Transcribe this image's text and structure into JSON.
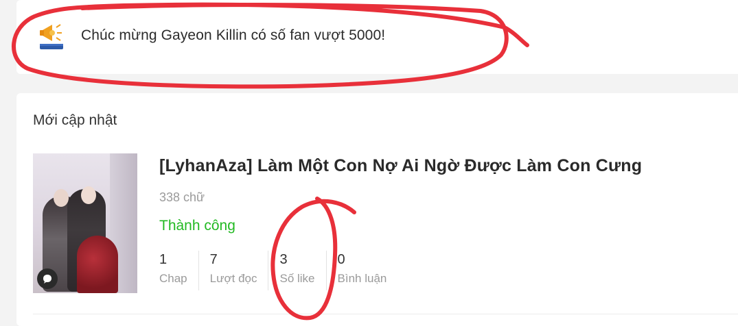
{
  "announcement": {
    "icon": "megaphone-icon",
    "text": "Chúc mừng Gayeon Killin có số fan vượt 5000!"
  },
  "updates": {
    "section_title": "Mới cập nhật",
    "book": {
      "title": "[LyhanAza] Làm Một Con Nợ Ai Ngờ Được Làm Con Cưng",
      "word_count": "338 chữ",
      "status": "Thành công",
      "status_color": "#22b922",
      "stats": [
        {
          "value": "1",
          "label": "Chap"
        },
        {
          "value": "7",
          "label": "Lượt đọc"
        },
        {
          "value": "3",
          "label": "Số like"
        },
        {
          "value": "0",
          "label": "Bình luận"
        }
      ]
    }
  },
  "annotation_color": "#e8303a"
}
